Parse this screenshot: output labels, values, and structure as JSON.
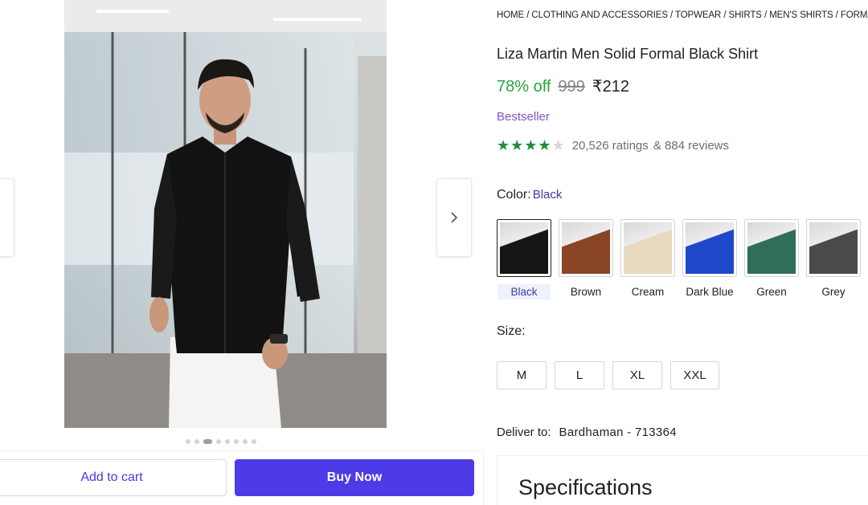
{
  "breadcrumb": [
    "HOME",
    "CLOTHING AND ACCESSORIES",
    "TOPWEAR",
    "SHIRTS",
    "MEN'S SHIRTS",
    "FORMAL"
  ],
  "product": {
    "title": "Liza Martin Men Solid Formal Black Shirt",
    "discount": "78% off",
    "mrp": "999",
    "price": "₹212",
    "badge": "Bestseller",
    "rating_value": 4,
    "ratings": "20,526 ratings",
    "reviews": "& 884 reviews"
  },
  "color": {
    "label": "Color:",
    "selected": "Black",
    "options": [
      {
        "name": "Black",
        "swatch": "#151515"
      },
      {
        "name": "Brown",
        "swatch": "#8a4426"
      },
      {
        "name": "Cream",
        "swatch": "#e8d9c0"
      },
      {
        "name": "Dark Blue",
        "swatch": "#1d49c9"
      },
      {
        "name": "Green",
        "swatch": "#2f6e5a"
      },
      {
        "name": "Grey",
        "swatch": "#4a4a4d"
      }
    ]
  },
  "size": {
    "label": "Size:",
    "options": [
      "M",
      "L",
      "XL",
      "XXL"
    ]
  },
  "delivery": {
    "label": "Deliver to:",
    "location": "Bardhaman - 713364"
  },
  "actions": {
    "add_to_cart": "Add to cart",
    "buy_now": "Buy Now"
  },
  "gallery": {
    "image_count": 8,
    "active_index": 2
  },
  "specifications": {
    "title": "Specifications"
  },
  "colors": {
    "accent": "#4d3be8",
    "discount": "#26a541",
    "badge": "#7b56c4",
    "star": "#1f8c3a"
  }
}
